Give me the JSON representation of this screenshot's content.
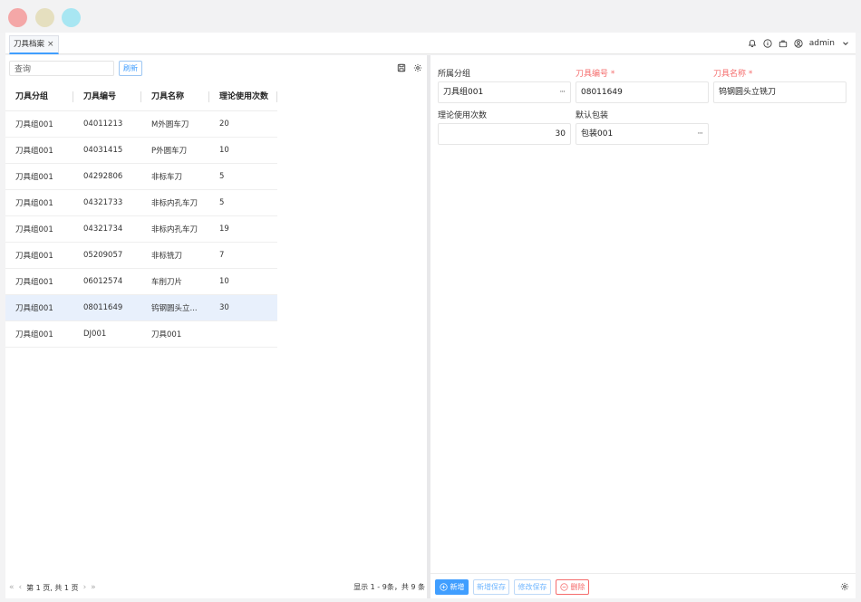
{
  "window": {
    "dot_colors": [
      "#f4a7a7",
      "#e5dfbf",
      "#a8e6f2"
    ]
  },
  "tabs": [
    {
      "label": "刀具档案",
      "close": "×"
    }
  ],
  "header": {
    "user": "admin",
    "icons": [
      "bell-icon",
      "info-icon",
      "briefcase-icon",
      "user-circle-icon",
      "chevron-down-icon"
    ]
  },
  "toolbar": {
    "search_placeholder": "查询",
    "refresh_label": "刷新",
    "icons": [
      "save-icon",
      "gear-icon"
    ]
  },
  "table": {
    "columns": [
      "刀具分组",
      "刀具编号",
      "刀具名称",
      "理论使用次数"
    ],
    "rows": [
      [
        "刀具组001",
        "04011213",
        "M外圆车刀",
        "20"
      ],
      [
        "刀具组001",
        "04031415",
        "P外圆车刀",
        "10"
      ],
      [
        "刀具组001",
        "04292806",
        "非标车刀",
        "5"
      ],
      [
        "刀具组001",
        "04321733",
        "非标内孔车刀",
        "5"
      ],
      [
        "刀具组001",
        "04321734",
        "非标内孔车刀",
        "19"
      ],
      [
        "刀具组001",
        "05209057",
        "非标铣刀",
        "7"
      ],
      [
        "刀具组001",
        "06012574",
        "车削刀片",
        "10"
      ],
      [
        "刀具组001",
        "08011649",
        "钨钢圆头立...",
        "30"
      ],
      [
        "刀具组001",
        "DJ001",
        "刀具001",
        ""
      ]
    ],
    "selected_row": 7
  },
  "pager": {
    "page_text": "第 1 页, 共 1 页",
    "summary": "显示 1 - 9条，共 9 条"
  },
  "form": {
    "group_label": "所属分组",
    "group_value": "刀具组001",
    "code_label": "刀具编号 *",
    "code_value": "08011649",
    "name_label": "刀具名称 *",
    "name_value": "钨钢圆头立铣刀",
    "uses_label": "理论使用次数",
    "uses_value": "30",
    "package_label": "默认包装",
    "package_value": "包装001",
    "ellipsis": "···"
  },
  "actions": {
    "add": "新增",
    "add_save": "新增保存",
    "edit_save": "修改保存",
    "delete": "删除"
  },
  "colors": {
    "accent": "#409eff",
    "danger": "#f56c6c",
    "selected_row": "#e8f0fc"
  }
}
